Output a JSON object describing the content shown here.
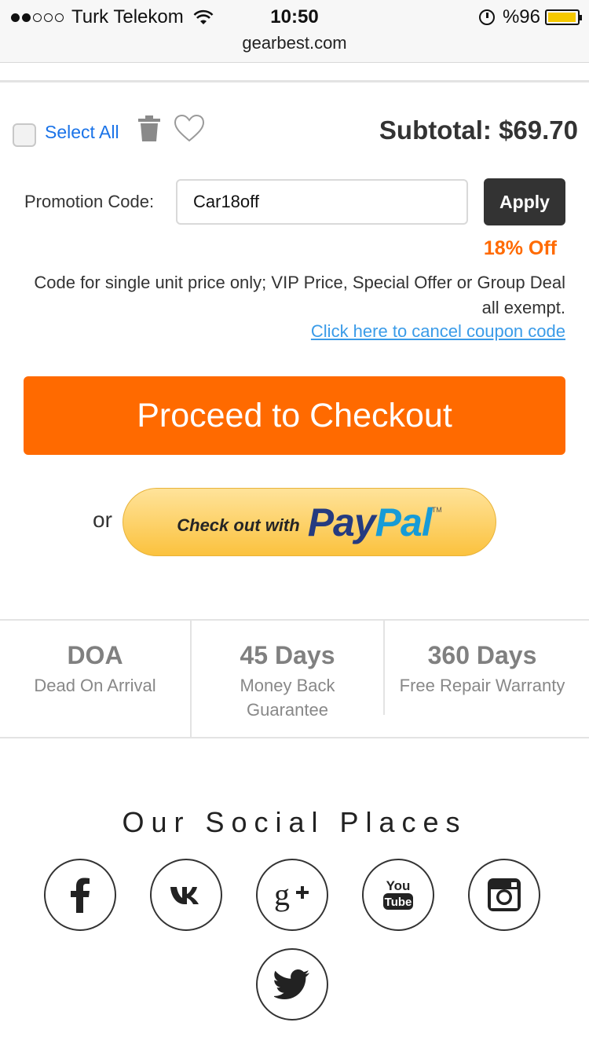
{
  "status_bar": {
    "carrier": "Turk Telekom",
    "time": "10:50",
    "url": "gearbest.com",
    "battery": "%96",
    "battery_level": 0.96
  },
  "cart": {
    "select_all": "Select All",
    "subtotal": "Subtotal: $69.70"
  },
  "promo": {
    "label": "Promotion Code:",
    "value": "Car18off",
    "apply": "Apply",
    "discount": "18% Off",
    "note": "Code for single unit price only; VIP Price, Special Offer or Group Deal all exempt.",
    "cancel_link": "Click here to cancel coupon code"
  },
  "checkout": {
    "button": "Proceed to Checkout",
    "or": "or",
    "paypal_prefix": "Check out with",
    "paypal_pay": "Pay",
    "paypal_pal": "Pal",
    "paypal_tm": "TM"
  },
  "guarantees": [
    {
      "title": "DOA",
      "line1": "Dead On Arrival",
      "line2": ""
    },
    {
      "title": "45 Days",
      "line1": "Money Back",
      "line2": "Guarantee"
    },
    {
      "title": "360 Days",
      "line1": "Free Repair Warranty",
      "line2": ""
    }
  ],
  "social": {
    "title": "Our Social Places",
    "icons": [
      "facebook-icon",
      "vk-icon",
      "google-plus-icon",
      "youtube-icon",
      "instagram-icon",
      "twitter-icon"
    ]
  },
  "colors": {
    "accent": "#ff6a00",
    "link": "#1a73e8",
    "dark_button": "#333333",
    "paypal_yellow": "#fbc23e"
  }
}
